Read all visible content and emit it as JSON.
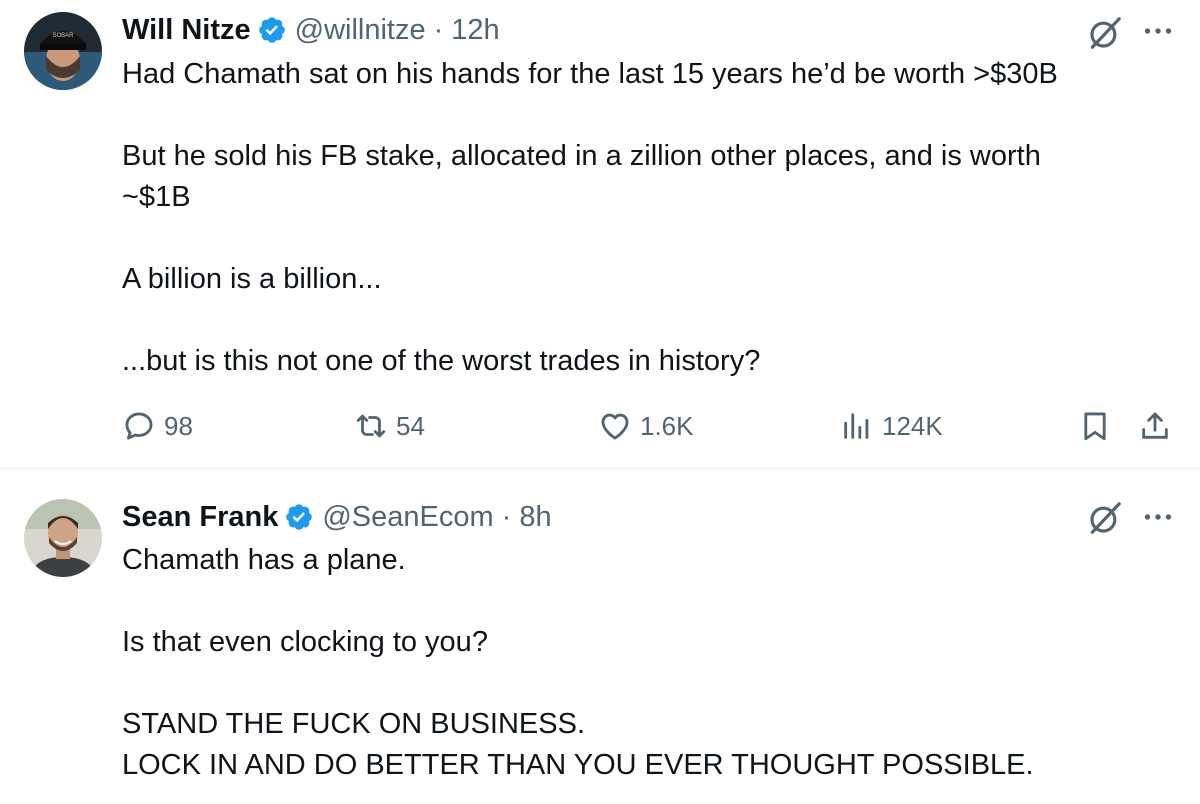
{
  "tweets": [
    {
      "name": "Will Nitze",
      "handle": "@willnitze",
      "separator": "·",
      "time": "12h",
      "body": [
        "Had Chamath sat on his hands for the last 15 years he’d be worth >$30B",
        "",
        "But he sold his FB stake, allocated in a zillion other places, and is worth",
        "~$1B",
        "",
        "A billion is a billion...",
        "",
        "...but is this not one of the worst trades in history?"
      ],
      "actions": {
        "replies": "98",
        "reposts": "54",
        "likes": "1.6K",
        "views": "124K"
      },
      "avatar_hat_text": "SOBAR"
    },
    {
      "name": "Sean Frank",
      "handle": "@SeanEcom",
      "separator": "·",
      "time": "8h",
      "body": [
        "Chamath has a plane.",
        "",
        "Is that even clocking to you?",
        "",
        "STAND THE FUCK ON BUSINESS.",
        "LOCK IN AND DO BETTER THAN YOU EVER THOUGHT POSSIBLE."
      ]
    }
  ],
  "icons": {
    "verified": "verified-badge-icon",
    "grok": "grok-icon",
    "more": "more-icon",
    "reply": "reply-icon",
    "repost": "repost-icon",
    "like": "heart-icon",
    "views": "views-icon",
    "bookmark": "bookmark-icon",
    "share": "share-icon"
  },
  "colors": {
    "text": "#0f1419",
    "muted": "#536471",
    "verified": "#1d9bf0",
    "divider": "#e6ecf0"
  }
}
